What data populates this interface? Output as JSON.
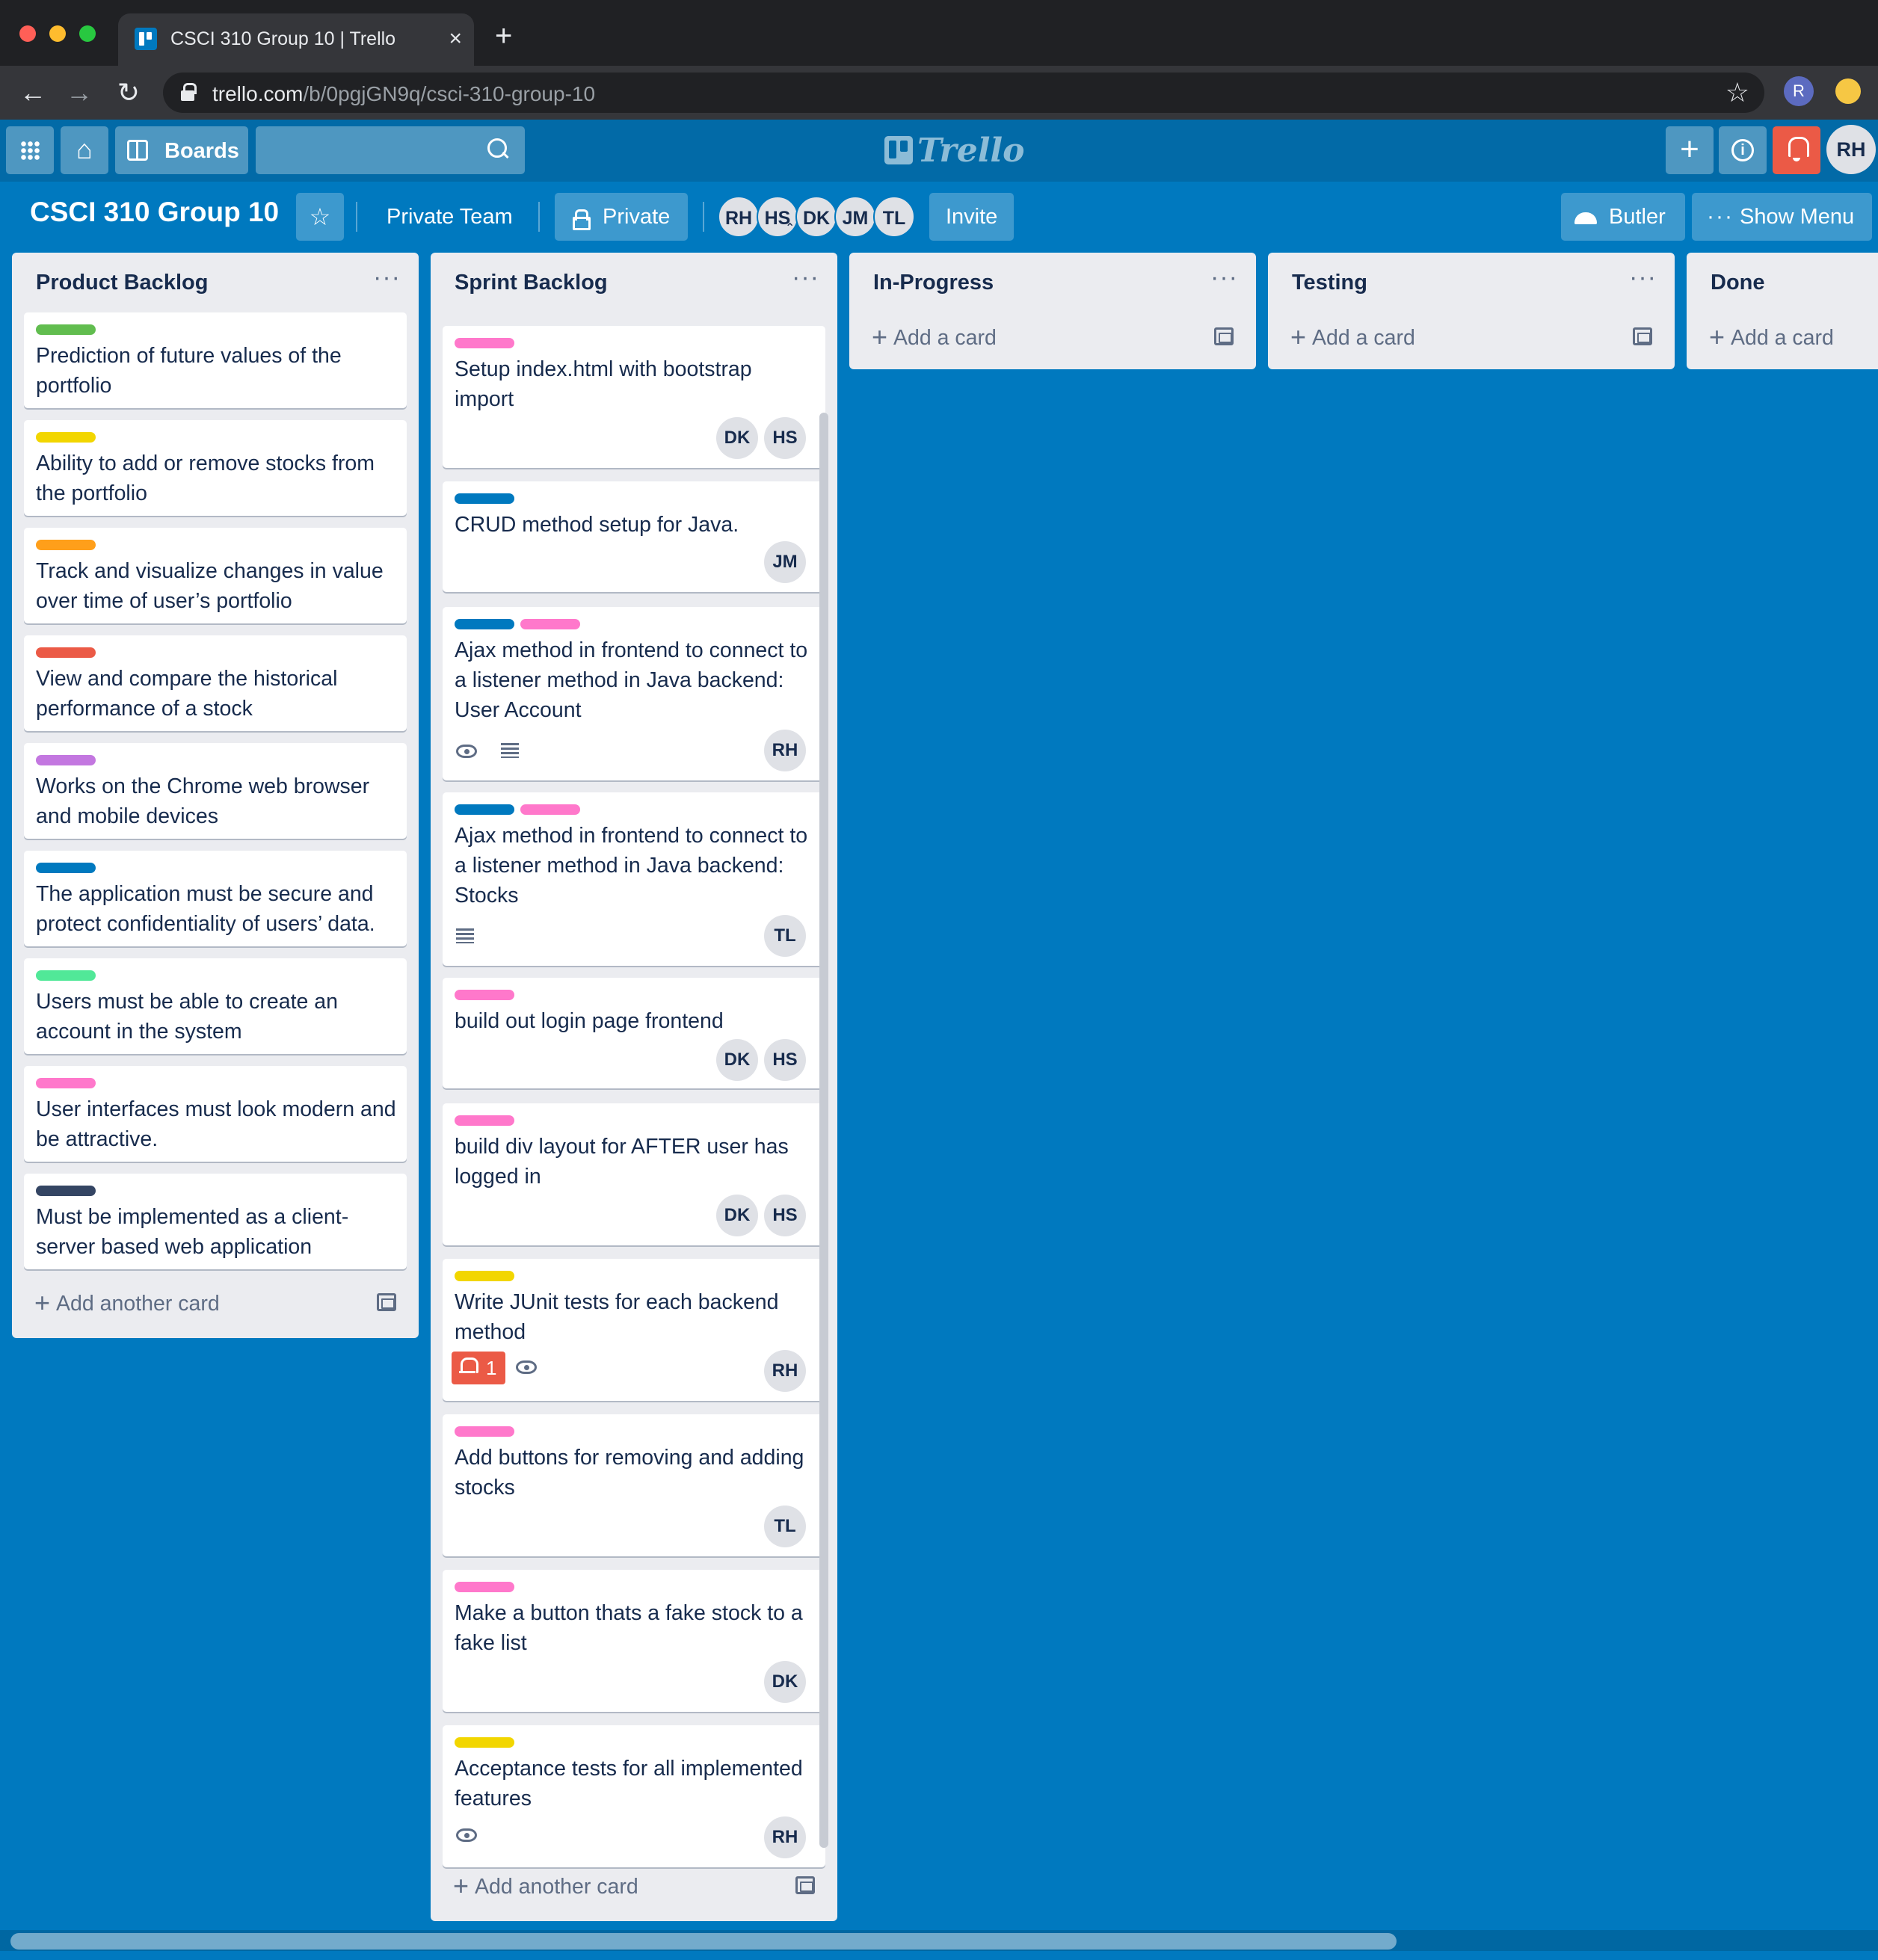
{
  "browser": {
    "tab_title": "CSCI 310 Group 10 | Trello",
    "tab_close": "×",
    "new_tab": "+",
    "url_host": "trello.com",
    "url_path": "/b/0pgjGN9q/csci-310-group-10",
    "back": "←",
    "forward": "→",
    "reload": "↻",
    "bookmark": "☆",
    "profile_initial": "R"
  },
  "header": {
    "home_glyph": "⌂",
    "boards_label": "Boards",
    "logo_text": "Trello",
    "plus_glyph": "+",
    "info_glyph": "i",
    "user_initials": "RH"
  },
  "board": {
    "title": "CSCI 310 Group 10",
    "star_glyph": "☆",
    "team": "Private Team",
    "visibility": "Private",
    "members": [
      "RH",
      "HS",
      "DK",
      "JM",
      "TL"
    ],
    "admin_marker": "⌃⌃",
    "invite": "Invite",
    "butler": "Butler",
    "show_menu": "Show Menu",
    "menu_dots": "···"
  },
  "lists": [
    {
      "title": "Product Backlog",
      "menu": "···",
      "add_label": "Add another card",
      "cards": [
        {
          "label_colors": [
            "#61bd4f"
          ],
          "text": "Prediction of future values of the portfolio"
        },
        {
          "label_colors": [
            "#f2d600"
          ],
          "text": "Ability to add or remove stocks from the portfolio"
        },
        {
          "label_colors": [
            "#ff9f1a"
          ],
          "text": "Track and visualize changes in value over time of user’s portfolio"
        },
        {
          "label_colors": [
            "#eb5a46"
          ],
          "text": "View and compare the historical performance of a stock"
        },
        {
          "label_colors": [
            "#c377e0"
          ],
          "text": "Works on the Chrome web browser and mobile devices"
        },
        {
          "label_colors": [
            "#0079bf"
          ],
          "text": "The application must be secure and protect confidentiality of users’ data."
        },
        {
          "label_colors": [
            "#51e898"
          ],
          "text": "Users must be able to create an account in the system"
        },
        {
          "label_colors": [
            "#ff78cb"
          ],
          "text": "User interfaces must look modern and be attractive."
        },
        {
          "label_colors": [
            "#344563"
          ],
          "text": "Must be implemented as a client-server based web application"
        }
      ]
    },
    {
      "title": "Sprint Backlog",
      "menu": "···",
      "add_label": "Add another card",
      "cards": [
        {
          "label_colors": [
            "#ff78cb"
          ],
          "text": "Setup index.html with bootstrap import",
          "members": [
            "DK",
            "HS"
          ]
        },
        {
          "label_colors": [
            "#0079bf"
          ],
          "text": "CRUD method setup for Java.",
          "members": [
            "JM"
          ]
        },
        {
          "label_colors": [
            "#0079bf",
            "#ff78cb"
          ],
          "text": "Ajax method in frontend to connect to a listener method in Java backend: User Account",
          "members": [
            "RH"
          ],
          "badges": [
            "eye-icon",
            "description-icon"
          ]
        },
        {
          "label_colors": [
            "#0079bf",
            "#ff78cb"
          ],
          "text": "Ajax method in frontend to connect to a listener method in Java backend: Stocks",
          "members": [
            "TL"
          ],
          "badges": [
            "description-icon"
          ]
        },
        {
          "label_colors": [
            "#ff78cb"
          ],
          "text": "build out login page frontend",
          "members": [
            "DK",
            "HS"
          ]
        },
        {
          "label_colors": [
            "#ff78cb"
          ],
          "text": "build div layout for AFTER user has logged in",
          "members": [
            "DK",
            "HS"
          ]
        },
        {
          "label_colors": [
            "#f2d600"
          ],
          "text": "Write JUnit tests for each backend method",
          "members": [
            "RH"
          ],
          "badges": [
            "due-bell-icon",
            "eye-icon"
          ],
          "due_count": "1"
        },
        {
          "label_colors": [
            "#ff78cb"
          ],
          "text": "Add buttons for removing and adding stocks",
          "members": [
            "TL"
          ]
        },
        {
          "label_colors": [
            "#ff78cb"
          ],
          "text": "Make a button thats a fake stock to a fake list",
          "members": [
            "DK"
          ]
        },
        {
          "label_colors": [
            "#f2d600"
          ],
          "text": "Acceptance tests for all implemented features",
          "members": [
            "RH"
          ],
          "badges": [
            "eye-icon"
          ]
        }
      ]
    },
    {
      "title": "In-Progress",
      "menu": "···",
      "add_label": "Add a card",
      "cards": []
    },
    {
      "title": "Testing",
      "menu": "···",
      "add_label": "Add a card",
      "cards": []
    },
    {
      "title": "Done",
      "add_label": "Add a card",
      "cards": []
    }
  ],
  "colors": {
    "board_bg": "#0079bf",
    "header_bg": "#026aa7",
    "list_bg": "#ebecf0",
    "notification": "#eb5a46"
  }
}
